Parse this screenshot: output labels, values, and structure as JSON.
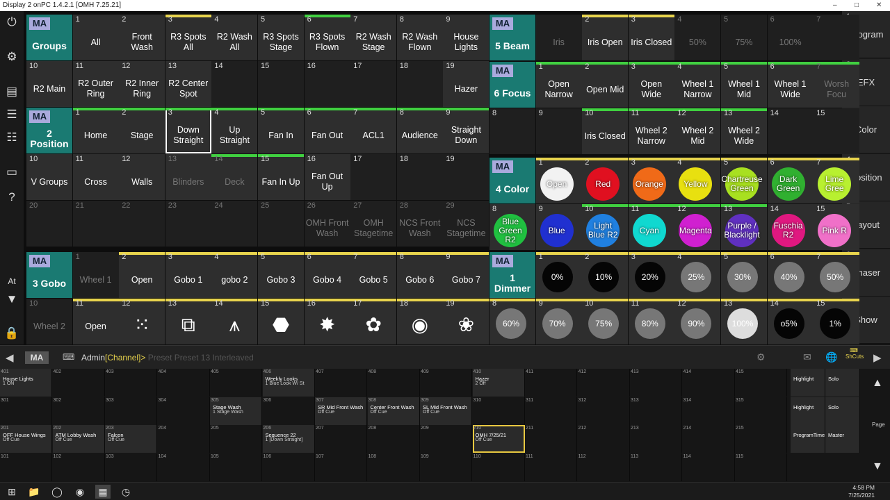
{
  "window": {
    "title": "Display 2 onPC 1.4.2.1 [OMH 7.25.21]"
  },
  "left_toolbar": [
    "power-icon",
    "settings-icon",
    "window-icon",
    "faders-icon",
    "sliders-icon",
    "monitor-icon",
    "help-icon"
  ],
  "left_toolbar_labels": {
    "at": "At"
  },
  "right_toolbar": [
    {
      "num": "1",
      "label": "Program"
    },
    {
      "num": "2",
      "label": "EFX"
    },
    {
      "num": "3",
      "label": "Color"
    },
    {
      "num": "4",
      "label": "Position"
    },
    {
      "num": "5",
      "label": "Layout"
    },
    {
      "num": "6",
      "label": "Phaser"
    },
    {
      "num": "7",
      "label": "Show"
    }
  ],
  "groups": {
    "title": "Groups",
    "row1": [
      {
        "n": "1",
        "l": "All"
      },
      {
        "n": "2",
        "l": "Front Wash"
      },
      {
        "n": "3",
        "l": "R3 Spots All"
      },
      {
        "n": "4",
        "l": "R2 Wash All"
      },
      {
        "n": "5",
        "l": "R3 Spots Stage"
      },
      {
        "n": "6",
        "l": "R3 Spots Flown"
      },
      {
        "n": "7",
        "l": "R2 Wash Stage"
      },
      {
        "n": "8",
        "l": "R2 Wash Flown"
      },
      {
        "n": "9",
        "l": "House Lights"
      }
    ],
    "row2": [
      {
        "n": "10",
        "l": "R2 Main"
      },
      {
        "n": "11",
        "l": "R2 Outer Ring"
      },
      {
        "n": "12",
        "l": "R2 Inner Ring"
      },
      {
        "n": "13",
        "l": "R2 Center Spot"
      },
      {
        "n": "14",
        "l": ""
      },
      {
        "n": "15",
        "l": ""
      },
      {
        "n": "16",
        "l": ""
      },
      {
        "n": "17",
        "l": ""
      },
      {
        "n": "18",
        "l": ""
      },
      {
        "n": "19",
        "l": "Hazer"
      }
    ]
  },
  "beam": {
    "title": "5 Beam",
    "row1": [
      {
        "n": "",
        "l": "Iris"
      },
      {
        "n": "2",
        "l": "Iris Open"
      },
      {
        "n": "3",
        "l": "Iris Closed"
      },
      {
        "n": "4",
        "l": "50%"
      },
      {
        "n": "5",
        "l": "75%"
      },
      {
        "n": "6",
        "l": "100%"
      },
      {
        "n": "7",
        "l": ""
      }
    ]
  },
  "focus": {
    "title": "6 Focus",
    "row1": [
      {
        "n": "1",
        "l": "Open Narrow"
      },
      {
        "n": "2",
        "l": "Open Mid"
      },
      {
        "n": "3",
        "l": "Open Wide"
      },
      {
        "n": "4",
        "l": "Wheel 1 Narrow"
      },
      {
        "n": "5",
        "l": "Wheel 1 Mid"
      },
      {
        "n": "6",
        "l": "Wheel 1 Wide"
      },
      {
        "n": "7",
        "l": "Worsh Focu"
      }
    ],
    "row2": [
      {
        "n": "8",
        "l": ""
      },
      {
        "n": "9",
        "l": ""
      },
      {
        "n": "10",
        "l": "Iris Closed"
      },
      {
        "n": "11",
        "l": "Wheel 2 Narrow"
      },
      {
        "n": "12",
        "l": "Wheel 2 Mid"
      },
      {
        "n": "13",
        "l": "Wheel 2 Wide"
      },
      {
        "n": "14",
        "l": ""
      },
      {
        "n": "15",
        "l": ""
      }
    ]
  },
  "position": {
    "title": "2 Position",
    "row1": [
      {
        "n": "1",
        "l": "Home"
      },
      {
        "n": "2",
        "l": "Stage"
      },
      {
        "n": "3",
        "l": "Down Straight"
      },
      {
        "n": "4",
        "l": "Up Straight"
      },
      {
        "n": "5",
        "l": "Fan In"
      },
      {
        "n": "6",
        "l": "Fan Out"
      },
      {
        "n": "7",
        "l": "ACL1"
      },
      {
        "n": "8",
        "l": "Audience"
      },
      {
        "n": "9",
        "l": "Straight Down"
      }
    ],
    "row2": [
      {
        "n": "10",
        "l": "V Groups"
      },
      {
        "n": "11",
        "l": "Cross"
      },
      {
        "n": "12",
        "l": "Walls"
      },
      {
        "n": "13",
        "l": "Blinders"
      },
      {
        "n": "14",
        "l": "Deck"
      },
      {
        "n": "15",
        "l": "Fan In Up"
      },
      {
        "n": "16",
        "l": "Fan Out Up"
      },
      {
        "n": "17",
        "l": ""
      },
      {
        "n": "18",
        "l": ""
      },
      {
        "n": "19",
        "l": ""
      }
    ],
    "row3": [
      {
        "n": "20",
        "l": ""
      },
      {
        "n": "21",
        "l": ""
      },
      {
        "n": "22",
        "l": ""
      },
      {
        "n": "23",
        "l": ""
      },
      {
        "n": "24",
        "l": ""
      },
      {
        "n": "25",
        "l": ""
      },
      {
        "n": "26",
        "l": "OMH Front Wash"
      },
      {
        "n": "27",
        "l": "OMH Stagetime"
      },
      {
        "n": "28",
        "l": "NCS Front Wash"
      },
      {
        "n": "29",
        "l": "NCS Stagetime"
      }
    ]
  },
  "color": {
    "title": "4 Color",
    "row1": [
      {
        "n": "1",
        "l": "Open",
        "c": "#f2f2f2"
      },
      {
        "n": "2",
        "l": "Red",
        "c": "#e01020"
      },
      {
        "n": "3",
        "l": "Orange",
        "c": "#f06a18"
      },
      {
        "n": "4",
        "l": "Yellow",
        "c": "#e8e010"
      },
      {
        "n": "5",
        "l": "Chartreuse Green",
        "c": "#a8e020"
      },
      {
        "n": "6",
        "l": "Dark Green",
        "c": "#30b030"
      },
      {
        "n": "7",
        "l": "Lime Gree",
        "c": "#b8f030"
      }
    ],
    "row2": [
      {
        "n": "8",
        "l": "Blue Green R2",
        "c": "#20c040"
      },
      {
        "n": "9",
        "l": "Blue",
        "c": "#2030d0"
      },
      {
        "n": "10",
        "l": "Light Blue R2",
        "c": "#2080e0"
      },
      {
        "n": "11",
        "l": "Cyan",
        "c": "#10d8d0"
      },
      {
        "n": "12",
        "l": "Magenta",
        "c": "#d020d0"
      },
      {
        "n": "13",
        "l": "Purple / Blacklight",
        "c": "#6030c0"
      },
      {
        "n": "14",
        "l": "Fuschia R2",
        "c": "#e01880"
      },
      {
        "n": "15",
        "l": "Pink R",
        "c": "#f070c8"
      }
    ]
  },
  "gobo": {
    "title": "3 Gobo",
    "row1": [
      {
        "n": "1",
        "l": "Wheel 1"
      },
      {
        "n": "2",
        "l": "Open"
      },
      {
        "n": "3",
        "l": "Gobo 1"
      },
      {
        "n": "4",
        "l": "gobo 2"
      },
      {
        "n": "5",
        "l": "Gobo 3"
      },
      {
        "n": "6",
        "l": "Gobo 4"
      },
      {
        "n": "7",
        "l": "Gobo 5"
      },
      {
        "n": "8",
        "l": "Gobo 6"
      },
      {
        "n": "9",
        "l": "Gobo 7"
      }
    ],
    "row2": [
      {
        "n": "10",
        "l": "Wheel 2"
      },
      {
        "n": "11",
        "l": "Open"
      },
      {
        "n": "12",
        "l": ""
      },
      {
        "n": "13",
        "l": ""
      },
      {
        "n": "14",
        "l": ""
      },
      {
        "n": "15",
        "l": ""
      },
      {
        "n": "16",
        "l": ""
      },
      {
        "n": "17",
        "l": ""
      },
      {
        "n": "18",
        "l": ""
      },
      {
        "n": "19",
        "l": ""
      }
    ]
  },
  "dimmer": {
    "title": "1 Dimmer",
    "row1": [
      {
        "n": "1",
        "l": "0%"
      },
      {
        "n": "2",
        "l": "10%"
      },
      {
        "n": "3",
        "l": "20%"
      },
      {
        "n": "4",
        "l": "25%"
      },
      {
        "n": "5",
        "l": "30%"
      },
      {
        "n": "6",
        "l": "40%"
      },
      {
        "n": "7",
        "l": "50%"
      }
    ],
    "row2": [
      {
        "n": "8",
        "l": "60%"
      },
      {
        "n": "9",
        "l": "70%"
      },
      {
        "n": "10",
        "l": "75%"
      },
      {
        "n": "11",
        "l": "80%"
      },
      {
        "n": "12",
        "l": "90%"
      },
      {
        "n": "13",
        "l": "100%"
      },
      {
        "n": "14",
        "l": "o5%"
      },
      {
        "n": "15",
        "l": "1%"
      }
    ]
  },
  "command_line": {
    "user": "Admin",
    "prompt": "[Channel]>",
    "ghost": "Preset Preset 13 Interleaved"
  },
  "executors": {
    "row4": [
      {
        "no": "401",
        "nm": "House Lights",
        "sub": "1 ON"
      },
      {
        "no": "402"
      },
      {
        "no": "403"
      },
      {
        "no": "404"
      },
      {
        "no": "405"
      },
      {
        "no": "406",
        "nm": "Weekly Looks",
        "sub": "1 Blue Look W/ St"
      },
      {
        "no": "407"
      },
      {
        "no": "408"
      },
      {
        "no": "409"
      },
      {
        "no": "410",
        "nm": "Hazer",
        "sub": "2 Off"
      },
      {
        "no": "411"
      },
      {
        "no": "412"
      },
      {
        "no": "413"
      },
      {
        "no": "414"
      },
      {
        "no": "415"
      }
    ],
    "row3": [
      {
        "no": "301"
      },
      {
        "no": "302"
      },
      {
        "no": "303"
      },
      {
        "no": "304"
      },
      {
        "no": "305",
        "nm": "Stage Wash",
        "sub": "1 Stage Wash"
      },
      {
        "no": "306"
      },
      {
        "no": "307",
        "nm": "SR Mid Front Wash",
        "sub": "Off Cue"
      },
      {
        "no": "308",
        "nm": "Center Front Wash",
        "sub": "Off Cue"
      },
      {
        "no": "309",
        "nm": "SL Mid Front Wash",
        "sub": "Off Cue"
      },
      {
        "no": "310"
      },
      {
        "no": "311"
      },
      {
        "no": "312"
      },
      {
        "no": "313"
      },
      {
        "no": "314"
      },
      {
        "no": "315"
      }
    ],
    "row2": [
      {
        "no": "201",
        "nm": "OFF House Wings",
        "sub": "Off Cue"
      },
      {
        "no": "202",
        "nm": "ATM Lobby Wash",
        "sub": "Off Cue"
      },
      {
        "no": "203",
        "nm": "Falcon",
        "sub": "Off Cue"
      },
      {
        "no": "204"
      },
      {
        "no": "205"
      },
      {
        "no": "206",
        "nm": "Sequence 22",
        "sub": "1 [Down Straight]"
      },
      {
        "no": "207"
      },
      {
        "no": "208"
      },
      {
        "no": "209"
      },
      {
        "no": "210",
        "nm": "OMH 7/25/21",
        "sub": "Off Cue"
      },
      {
        "no": "211"
      },
      {
        "no": "212"
      },
      {
        "no": "213"
      },
      {
        "no": "214"
      },
      {
        "no": "215"
      }
    ],
    "row1": [
      {
        "no": "101"
      },
      {
        "no": "102"
      },
      {
        "no": "103"
      },
      {
        "no": "104"
      },
      {
        "no": "105"
      },
      {
        "no": "106"
      },
      {
        "no": "107"
      },
      {
        "no": "108"
      },
      {
        "no": "109"
      },
      {
        "no": "110"
      },
      {
        "no": "111"
      },
      {
        "no": "112"
      },
      {
        "no": "113"
      },
      {
        "no": "114"
      },
      {
        "no": "115"
      }
    ],
    "side": [
      {
        "nm": "Highlight"
      },
      {
        "nm": "Solo"
      },
      {
        "nm": "Highlight"
      },
      {
        "nm": "Solo"
      },
      {
        "nm": "ProgramTime"
      },
      {
        "nm": "Master"
      }
    ],
    "page_label": "Page"
  },
  "taskbar": {
    "time": "4:58 PM",
    "date": "7/25/2021"
  }
}
